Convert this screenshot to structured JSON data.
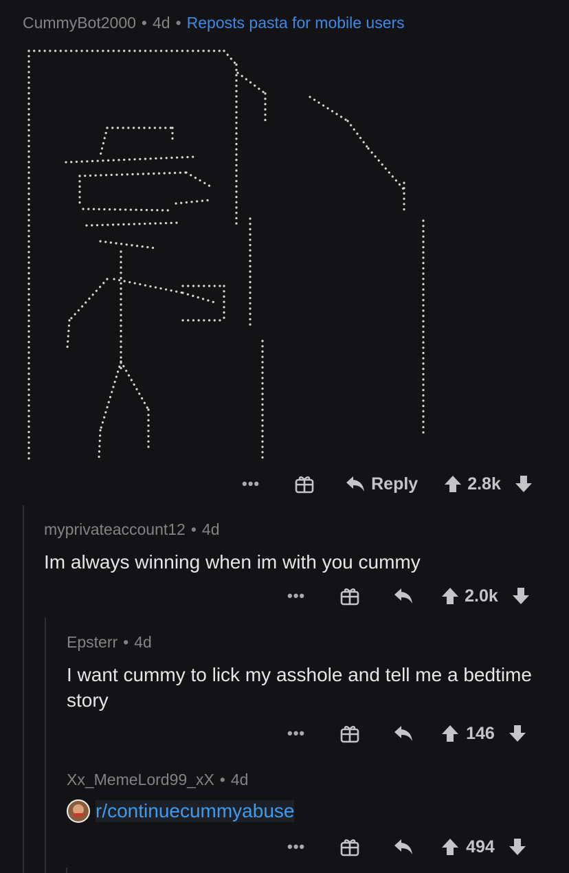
{
  "comments": [
    {
      "author": "CummyBot2000",
      "age": "4d",
      "flair": "Reposts pasta for mobile users",
      "actions": {
        "reply_label": "Reply",
        "score": "2.8k"
      }
    },
    {
      "author": "myprivateaccount12",
      "age": "4d",
      "text": "Im always winning when im with you cummy",
      "actions": {
        "score": "2.0k"
      }
    },
    {
      "author": "Epsterr",
      "age": "4d",
      "text": "I want cummy to lick my asshole and tell me a bedtime story",
      "actions": {
        "score": "146"
      }
    },
    {
      "author": "Xx_MemeLord99_xX",
      "age": "4d",
      "link": "r/continuecummyabuse",
      "actions": {
        "score": "494"
      }
    }
  ],
  "icons": {
    "more": "more-icon",
    "gift": "gift-icon",
    "reply": "reply-arrow-icon",
    "upvote": "upvote-arrow-icon",
    "downvote": "downvote-arrow-icon"
  },
  "colors": {
    "background": "#131315",
    "meta": "#818384",
    "flair": "#3c8ae6",
    "link": "#3d9bf0"
  }
}
